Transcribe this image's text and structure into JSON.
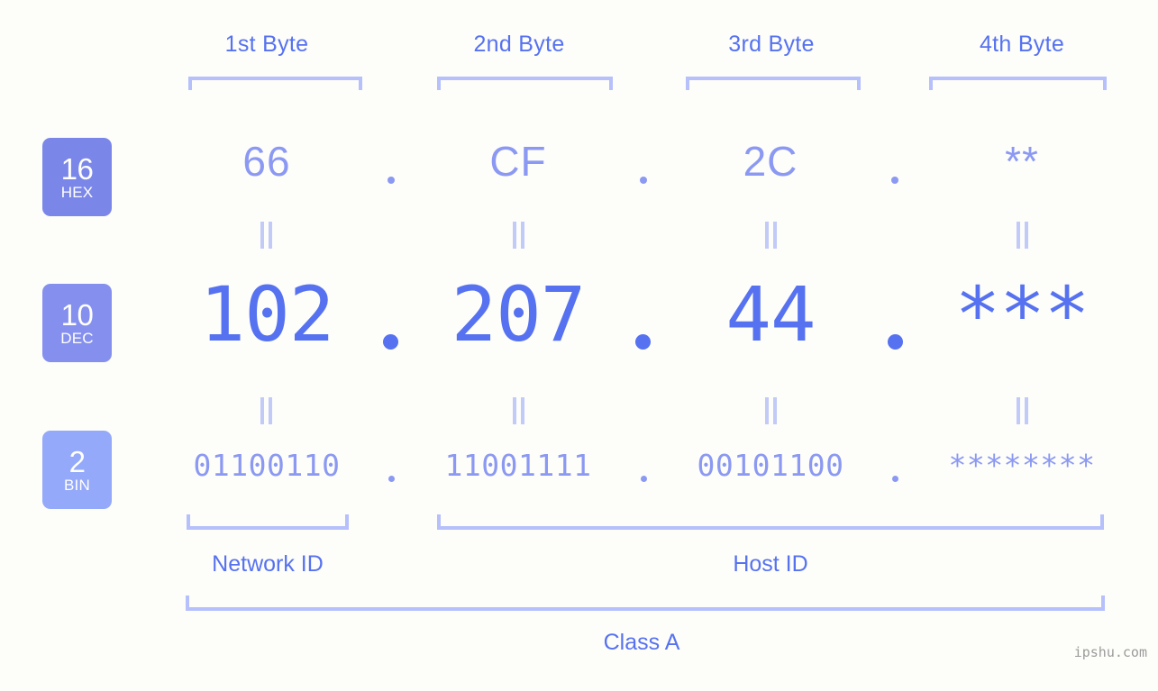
{
  "background": "#fdfdfa",
  "accent": "#5672f0",
  "accent_light": "#8b99f2",
  "bracket_color": "#b6c0fb",
  "columns": [
    {
      "header": "1st Byte"
    },
    {
      "header": "2nd Byte"
    },
    {
      "header": "3rd Byte"
    },
    {
      "header": "4th Byte"
    }
  ],
  "rows": [
    {
      "base": "16",
      "base_name": "HEX",
      "badge_color": "#7b87e8",
      "values": [
        "66",
        "CF",
        "2C",
        "**"
      ]
    },
    {
      "base": "10",
      "base_name": "DEC",
      "badge_color": "#8590ee",
      "values": [
        "102",
        "207",
        "44",
        "***"
      ]
    },
    {
      "base": "2",
      "base_name": "BIN",
      "badge_color": "#94a9f9",
      "values": [
        "01100110",
        "11001111",
        "00101100",
        "********"
      ]
    }
  ],
  "separator": ".",
  "sections": [
    {
      "label": "Network ID"
    },
    {
      "label": "Host ID"
    }
  ],
  "class_label": "Class A",
  "watermark": "ipshu.com"
}
